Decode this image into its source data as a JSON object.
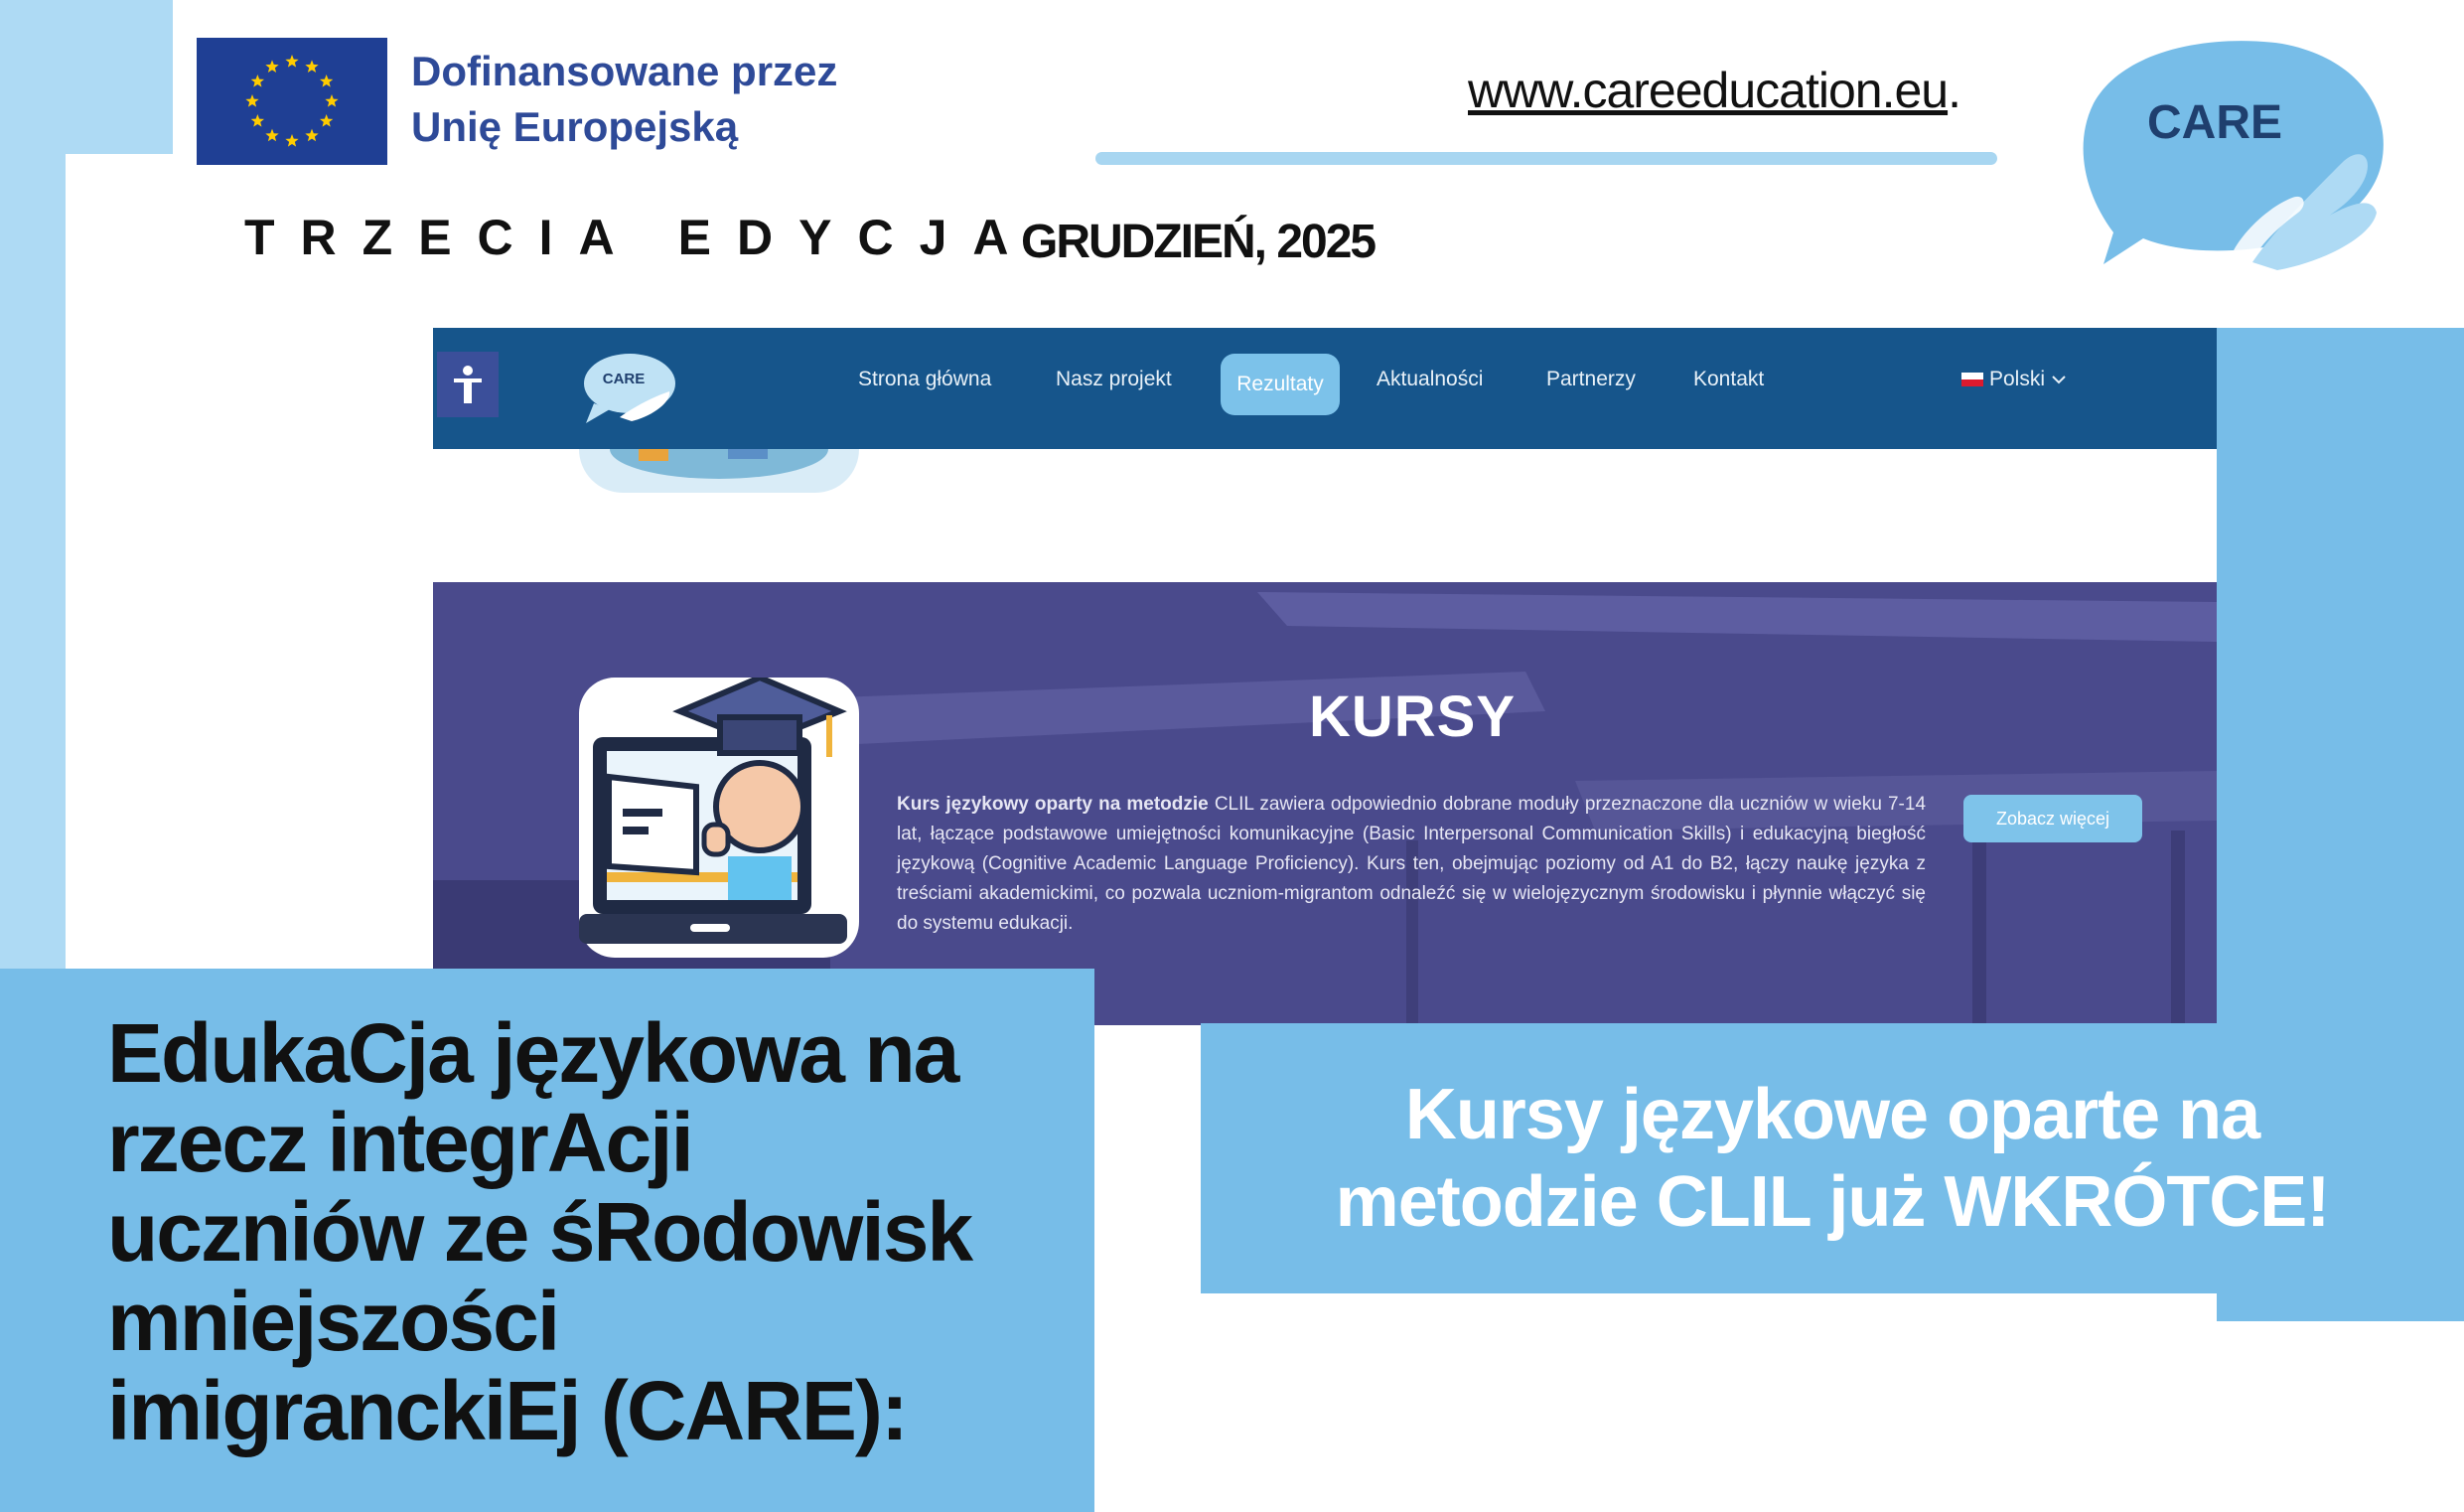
{
  "header": {
    "eu_funding_line1": "Dofinansowane przez",
    "eu_funding_line2": "Unię Europejską",
    "website": "www.careeducation.eu",
    "website_suffix": ".",
    "edition": "TRZECIA EDYCJA",
    "date": "GRUDZIEŃ, 2025",
    "logo_text": "CARE"
  },
  "site": {
    "logo_text": "CARE",
    "nav": [
      "Strona główna",
      "Nasz projekt",
      "Rezultaty",
      "Aktualności",
      "Partnerzy",
      "Kontakt"
    ],
    "active_nav": "Rezultaty",
    "language": "Polski",
    "hero": {
      "title": "KURSY",
      "description_bold": "Kurs językowy oparty na metodzie",
      "description": " CLIL zawiera odpowiednio dobrane moduły przeznaczone dla uczniów w wieku 7-14 lat, łączące podstawowe umiejętności komunikacyjne (Basic Interpersonal Communication Skills) i edukacyjną biegłość językową (Cognitive Academic Language Proficiency). Kurs ten, obejmując poziomy od A1 do B2, łączy naukę języka z treściami akademickimi, co pozwala uczniom-migrantom odnaleźć się w wielojęzycznym środowisku i płynnie włączyć się do systemu edukacji.",
      "button": "Zobacz więcej"
    }
  },
  "main_title_lines": [
    "EdukaCja językowa na",
    "rzecz integrAcji",
    "uczniów ze śRodowisk",
    "mniejszości",
    "imigranckiEj (CARE):"
  ],
  "announcement_lines": [
    "Kursy językowe oparte na",
    "metodzie CLIL już WKRÓTCE!"
  ],
  "colors": {
    "light_blue": "#aedaf4",
    "mid_blue": "#77bde8",
    "nav_blue": "#16558b",
    "eu_blue": "#1f3f94",
    "eu_star": "#ffcc00",
    "hero_purple": "#4b4a8e"
  },
  "icons": [
    "eu-flag-icon",
    "accessibility-icon",
    "care-speech-bubble-logo",
    "chevron-down-icon",
    "graduate-laptop-icon"
  ]
}
